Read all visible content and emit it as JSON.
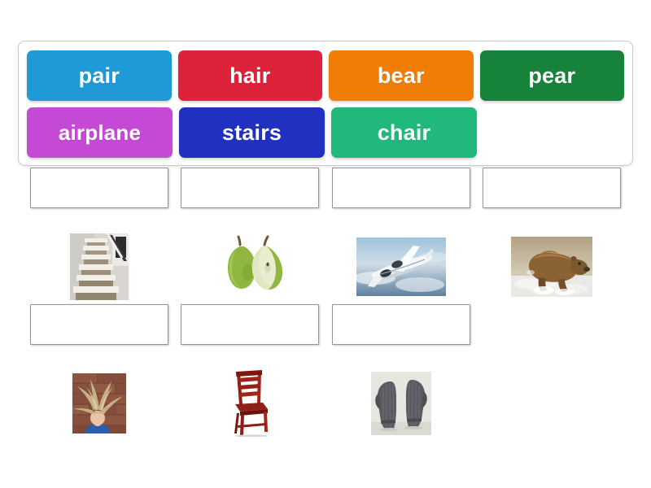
{
  "activity": {
    "type": "match-up-drag-and-drop",
    "word_bank": {
      "rows": [
        [
          {
            "label": "pair",
            "color": "#1f9ad6"
          },
          {
            "label": "hair",
            "color": "#dd2239"
          },
          {
            "label": "bear",
            "color": "#ef7d06"
          },
          {
            "label": "pear",
            "color": "#17833a"
          }
        ],
        [
          {
            "label": "airplane",
            "color": "#c44ad6"
          },
          {
            "label": "stairs",
            "color": "#2030c0"
          },
          {
            "label": "chair",
            "color": "#20b87b"
          }
        ]
      ]
    },
    "board": {
      "rows": [
        [
          {
            "dropzone_value": "",
            "image_name": "stairs-photo"
          },
          {
            "dropzone_value": "",
            "image_name": "pears-photo"
          },
          {
            "dropzone_value": "",
            "image_name": "airplane-photo"
          },
          {
            "dropzone_value": "",
            "image_name": "bear-photo"
          }
        ],
        [
          {
            "dropzone_value": "",
            "image_name": "hair-photo"
          },
          {
            "dropzone_value": "",
            "image_name": "chair-photo"
          },
          {
            "dropzone_value": "",
            "image_name": "mittens-pair-photo"
          }
        ]
      ]
    }
  },
  "colors": {
    "page_background": "#ffffff",
    "bank_border": "#c9c9c9",
    "dropzone_border": "#949494",
    "tile_text": "#ffffff"
  }
}
